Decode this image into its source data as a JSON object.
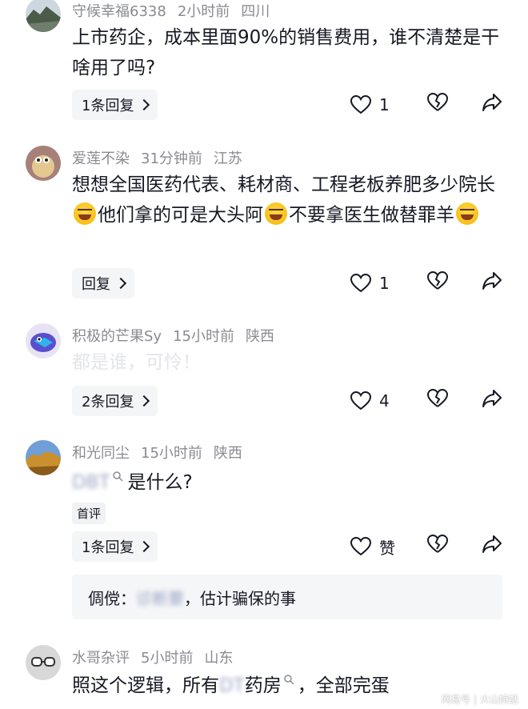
{
  "comments": [
    {
      "author": "守候幸福6338",
      "time": "2小时前",
      "location": "四川",
      "text": "上市药企，成本里面90%的销售费用，谁不清楚是干啥用了吗?",
      "reply_label": "1条回复",
      "like_count": "1"
    },
    {
      "author": "爱莲不染",
      "time": "31分钟前",
      "location": "江苏",
      "text_part1": "想想全国医药代表、耗材商、工程老板养肥多少院长",
      "text_part2": "他们拿的可是大头阿",
      "text_part3": "不要拿医生做替罪羊",
      "reply_label": "回复",
      "like_count": "1"
    },
    {
      "author": "积极的芒果Sy",
      "time": "15小时前",
      "location": "陕西",
      "text": "都是谁，可怜！",
      "reply_label": "2条回复",
      "like_count": "4"
    },
    {
      "author": "和光同尘",
      "time": "15小时前",
      "location": "陕西",
      "text_hidden": "DBT",
      "text": "是什么?",
      "badge": "首评",
      "reply_label": "1条回复",
      "like_label": "赞",
      "sub_reply_author": "倜傥：",
      "sub_reply_hidden": "诊断要",
      "sub_reply_text": "，估计骗保的事"
    },
    {
      "author": "水哥杂评",
      "time": "5小时前",
      "location": "山东",
      "text_a": "照这个逻辑，所有",
      "text_hidden": "DT",
      "text_b": "药房",
      "text_c": "，全部完蛋"
    }
  ],
  "watermark": {
    "left": "网易号",
    "sep": "|",
    "right": "火山詩話"
  },
  "colors": {
    "text": "#161823",
    "meta": "#8a8b91",
    "button_bg": "#f4f5f7"
  }
}
